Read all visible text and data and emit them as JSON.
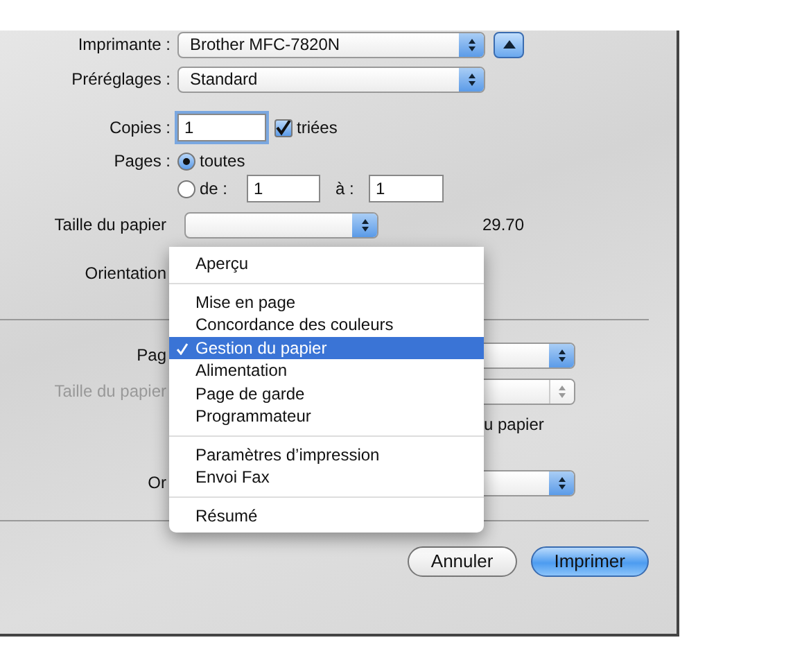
{
  "printer": {
    "label": "Imprimante :",
    "value": "Brother MFC-7820N"
  },
  "presets": {
    "label": "Préréglages :",
    "value": "Standard"
  },
  "copies": {
    "label": "Copies :",
    "value": "1",
    "collated": {
      "label": "triées",
      "checked": true
    }
  },
  "pages": {
    "label": "Pages :",
    "options": [
      {
        "label": "toutes",
        "selected": true
      },
      {
        "label": "de :",
        "selected": false
      }
    ],
    "from": "1",
    "to_label": "à :",
    "to": "1"
  },
  "paper_size": {
    "label": "Taille du papier",
    "reading": "29.70"
  },
  "orientation": {
    "label": "Orientation"
  },
  "panel_rows": [
    {
      "kind": "select",
      "label": "Pag",
      "disabled": false
    },
    {
      "kind": "select",
      "label": "Taille du papier",
      "disabled": true
    },
    {
      "kind": "text",
      "label": "u papier"
    },
    {
      "kind": "select",
      "label": "Or",
      "disabled": false
    }
  ],
  "menu": {
    "groups": [
      {
        "items": [
          {
            "label": "Aperçu",
            "selected": false
          }
        ]
      },
      {
        "items": [
          {
            "label": "Mise en page",
            "selected": false
          },
          {
            "label": "Concordance des couleurs",
            "selected": false
          },
          {
            "label": "Gestion du papier",
            "selected": true
          },
          {
            "label": "Alimentation",
            "selected": false
          },
          {
            "label": "Page de garde",
            "selected": false
          },
          {
            "label": "Programmateur",
            "selected": false
          }
        ]
      },
      {
        "items": [
          {
            "label": "Paramètres d’impression",
            "selected": false
          },
          {
            "label": "Envoi Fax",
            "selected": false
          }
        ]
      },
      {
        "items": [
          {
            "label": "Résumé",
            "selected": false
          }
        ]
      }
    ]
  },
  "buttons": [
    {
      "label": "Annuler",
      "kind": "default"
    },
    {
      "label": "Imprimer",
      "kind": "primary"
    }
  ]
}
